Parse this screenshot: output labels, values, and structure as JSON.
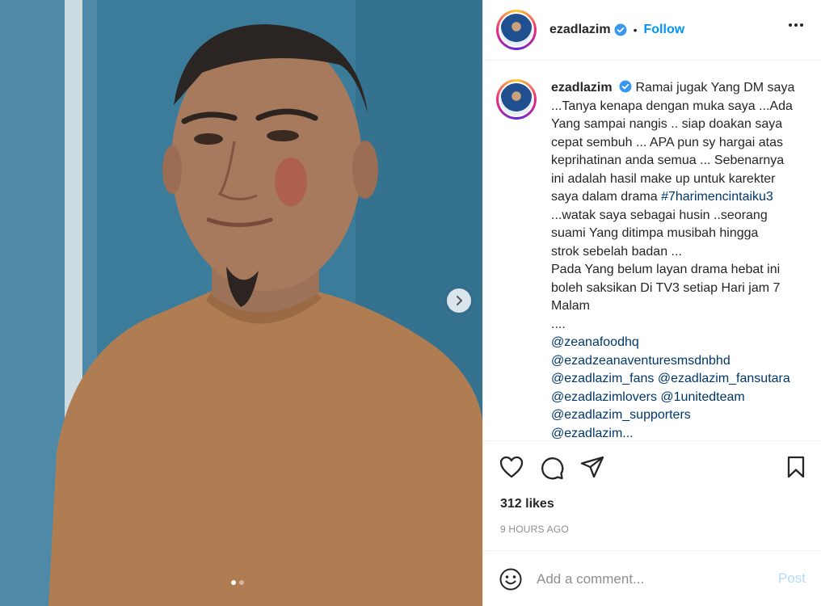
{
  "post": {
    "username": "ezadlazim",
    "follow_label": "Follow",
    "separator": "•",
    "caption_lines": [
      "Ramai jugak Yang DM saya",
      "...Tanya kenapa dengan muka saya ...Ada",
      "Yang sampai nangis .. siap doakan saya",
      "cepat sembuh ... APA pun sy hargai atas",
      "keprihatinan anda semua ... Sebenarnya",
      "ini adalah hasil make up untuk karekter",
      "saya dalam drama",
      "...watak saya sebagai husin ..seorang",
      "suami Yang ditimpa musibah hingga",
      "strok sebelah badan ...",
      "Pada Yang belum layan drama hebat ini",
      "boleh saksikan Di TV3 setiap Hari jam 7",
      "Malam",
      "...."
    ],
    "hashtag": "#7harimencintaiku3",
    "mentions": [
      "@zeanafoodhq",
      "@ezadzeanaventuresmsdnbhd",
      "@ezadlazim_fans",
      "@ezadlazim_fansutara",
      "@ezadlazimlovers",
      "@1unitedteam",
      "@ezadlazim_supporters",
      "@ezadlazim..."
    ],
    "likes": "312 likes",
    "time_ago": "9 HOURS AGO",
    "comment_placeholder": "Add a comment...",
    "post_label": "Post"
  },
  "carousel": {
    "slide_count": 2,
    "active_index": 0
  },
  "colors": {
    "link": "#0095f6",
    "mention": "#00376b",
    "verified": "#3897f0",
    "muted": "#8e8e8e"
  },
  "icons": [
    "more-icon",
    "verified-icon",
    "next-arrow-icon",
    "heart-icon",
    "comment-icon",
    "share-icon",
    "bookmark-icon",
    "emoji-icon"
  ]
}
